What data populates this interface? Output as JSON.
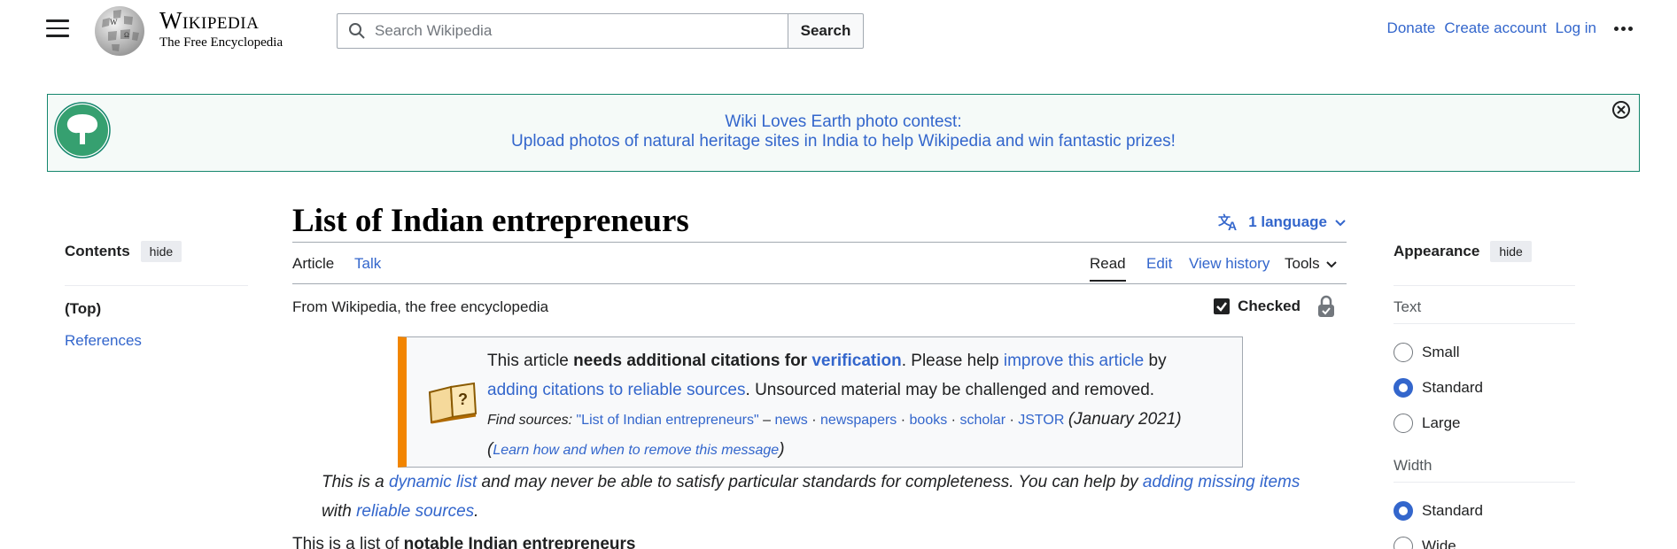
{
  "header": {
    "wordmark_title": "Wikipedia",
    "wordmark_tagline": "The Free Encyclopedia",
    "search_placeholder": "Search Wikipedia",
    "search_button": "Search",
    "user_links": {
      "donate": "Donate",
      "create_account": "Create account",
      "log_in": "Log in"
    }
  },
  "banner": {
    "line1": "Wiki Loves Earth photo contest:",
    "line2": "Upload photos of natural heritage sites in India to help Wikipedia and win fantastic prizes!"
  },
  "toc": {
    "title": "Contents",
    "hide": "hide",
    "items": [
      "(Top)",
      "References"
    ]
  },
  "page": {
    "title": "List of Indian entrepreneurs",
    "language_button": "1 language",
    "tabs_left": [
      "Article",
      "Talk"
    ],
    "tabs_right": [
      "Read",
      "Edit",
      "View history",
      "Tools"
    ],
    "tagline": "From Wikipedia, the free encyclopedia",
    "checked_label": "Checked"
  },
  "ambox": {
    "t1": "This article ",
    "t2": "needs additional citations for ",
    "t3": "verification",
    "t4": ". Please help ",
    "t5": "improve this article",
    "t6": " by",
    "t7": "adding citations to reliable sources",
    "t8": ". Unsourced material may be challenged and removed.",
    "fs_label": "Find sources: ",
    "fs_query": "\"List of Indian entrepreneurs\"",
    "fs_dash": " – ",
    "fs_links": [
      "news",
      "newspapers",
      "books",
      "scholar",
      "JSTOR"
    ],
    "fs_date": "(January 2021)",
    "learn_open": "(",
    "learn": "Learn how and when to remove this message",
    "learn_close": ")"
  },
  "dynlist": {
    "a": "This is a ",
    "b": "dynamic list",
    "c": " and may never be able to satisfy particular standards for completeness. You can help by ",
    "d": "adding missing items",
    "e": " with ",
    "f": "reliable sources",
    "g": "."
  },
  "lead": {
    "a": "This is a list of ",
    "b": "notable Indian entrepreneurs"
  },
  "appearance": {
    "title": "Appearance",
    "hide": "hide",
    "text_label": "Text",
    "text_options": [
      {
        "label": "Small",
        "selected": false
      },
      {
        "label": "Standard",
        "selected": true
      },
      {
        "label": "Large",
        "selected": false
      }
    ],
    "width_label": "Width",
    "width_options": [
      {
        "label": "Standard",
        "selected": true
      },
      {
        "label": "Wide",
        "selected": false
      }
    ]
  },
  "colors": {
    "link": "#3366cc",
    "ambox_accent": "#f28500",
    "banner_border": "#14866d"
  },
  "icons": [
    "menu-icon",
    "wikipedia-globe-logo",
    "search-icon",
    "more-icon",
    "tree-icon",
    "close-icon",
    "translate-icon",
    "chevron-down-icon",
    "checkbox-icon",
    "lock-icon",
    "book-question-icon"
  ]
}
